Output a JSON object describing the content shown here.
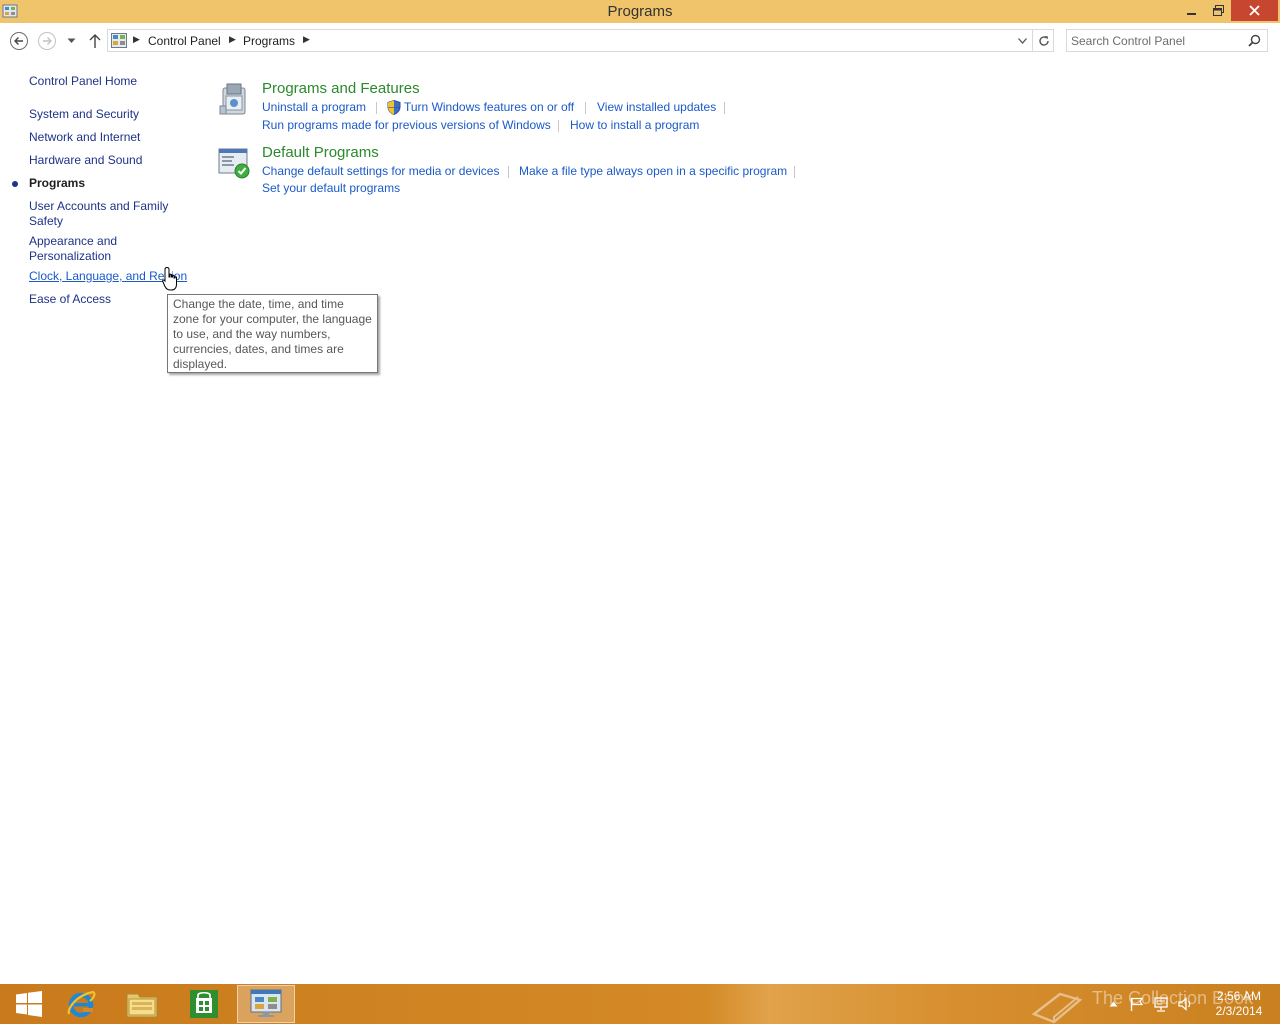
{
  "window": {
    "title": "Programs"
  },
  "address_bar": {
    "crumbs": [
      "Control Panel",
      "Programs"
    ]
  },
  "search": {
    "placeholder": "Search Control Panel"
  },
  "left_nav": {
    "items": [
      {
        "label": "Control Panel Home"
      },
      {
        "label": "System and Security"
      },
      {
        "label": "Network and Internet"
      },
      {
        "label": "Hardware and Sound"
      },
      {
        "label": "Programs",
        "current": true
      },
      {
        "label": "User Accounts and Family Safety"
      },
      {
        "label": "Appearance and Personalization"
      },
      {
        "label": "Clock, Language, and Region"
      },
      {
        "label": "Ease of Access"
      }
    ]
  },
  "categories": [
    {
      "title": "Programs and Features",
      "tasks": [
        "Uninstall a program",
        "Turn Windows features on or off",
        "View installed updates",
        "Run programs made for previous versions of Windows",
        "How to install a program"
      ]
    },
    {
      "title": "Default Programs",
      "tasks": [
        "Change default settings for media or devices",
        "Make a file type always open in a specific program",
        "Set your default programs"
      ]
    }
  ],
  "tooltip": {
    "text": "Change the date, time, and time zone for your computer, the language to use, and the way numbers, currencies, dates, and times are displayed."
  },
  "taskbar": {
    "clock_time": "2:56 AM",
    "clock_date": "2/3/2014",
    "watermark": "The Collection Book"
  },
  "colors": {
    "titlebar": "#f0c46a",
    "close_button": "#c7462f",
    "link": "#1a5ac9",
    "category_title": "#2b8a2b",
    "taskbar": "#d48a26"
  },
  "icons": [
    "control-panel-icon",
    "back-arrow-icon",
    "forward-arrow-icon",
    "up-arrow-icon",
    "refresh-icon",
    "search-icon",
    "uac-shield-icon",
    "windows-logo-icon",
    "internet-explorer-icon",
    "file-explorer-icon",
    "store-icon"
  ]
}
